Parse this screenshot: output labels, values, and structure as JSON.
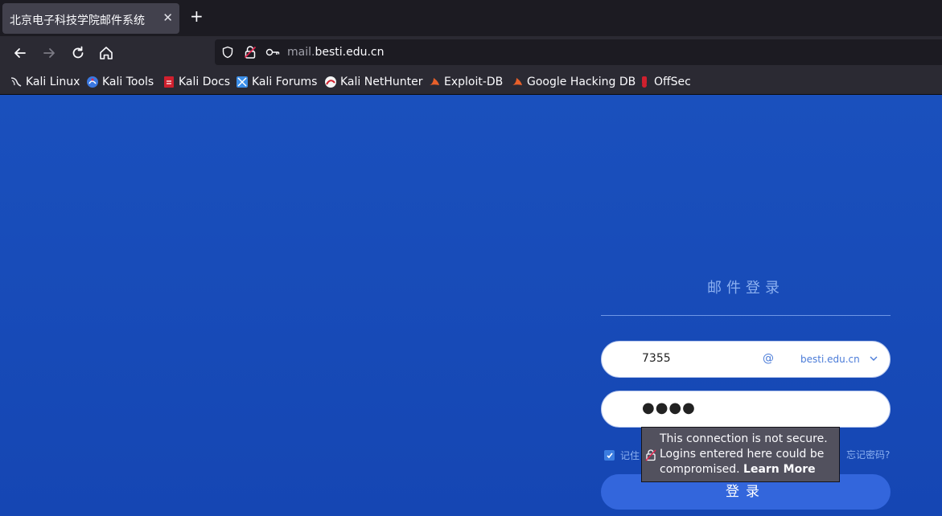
{
  "browser": {
    "tab": {
      "title": "北京电子科技学院邮件系统",
      "close_glyph": "✕"
    },
    "new_tab_glyph": "+",
    "address": {
      "prefix": "mail.",
      "host": "besti.edu.cn"
    },
    "bookmarks": [
      {
        "label": "Kali Linux",
        "icon": "kali-dragon-icon"
      },
      {
        "label": "Kali Tools",
        "icon": "kali-tools-icon"
      },
      {
        "label": "Kali Docs",
        "icon": "kali-docs-icon"
      },
      {
        "label": "Kali Forums",
        "icon": "kali-forums-icon"
      },
      {
        "label": "Kali NetHunter",
        "icon": "nethunter-icon"
      },
      {
        "label": "Exploit-DB",
        "icon": "exploit-db-icon"
      },
      {
        "label": "Google Hacking DB",
        "icon": "ghdb-icon"
      },
      {
        "label": "OffSec",
        "icon": "offsec-icon"
      }
    ]
  },
  "login": {
    "title": "邮件登录",
    "username_value": "7355",
    "at_symbol": "@",
    "domain": "besti.edu.cn",
    "password_value": "●●●●",
    "remember_label": "记住",
    "remember_checked": true,
    "forgot_label": "忘记密码?",
    "submit_label": "登录"
  },
  "tooltip": {
    "line1": "This connection is not secure.",
    "line2": "Logins entered here could be",
    "line3": "compromised.",
    "link": "Learn More"
  },
  "colors": {
    "page_bg": "#1a4fb8",
    "accent": "#3366dc",
    "toolbar": "#2b2a33"
  }
}
